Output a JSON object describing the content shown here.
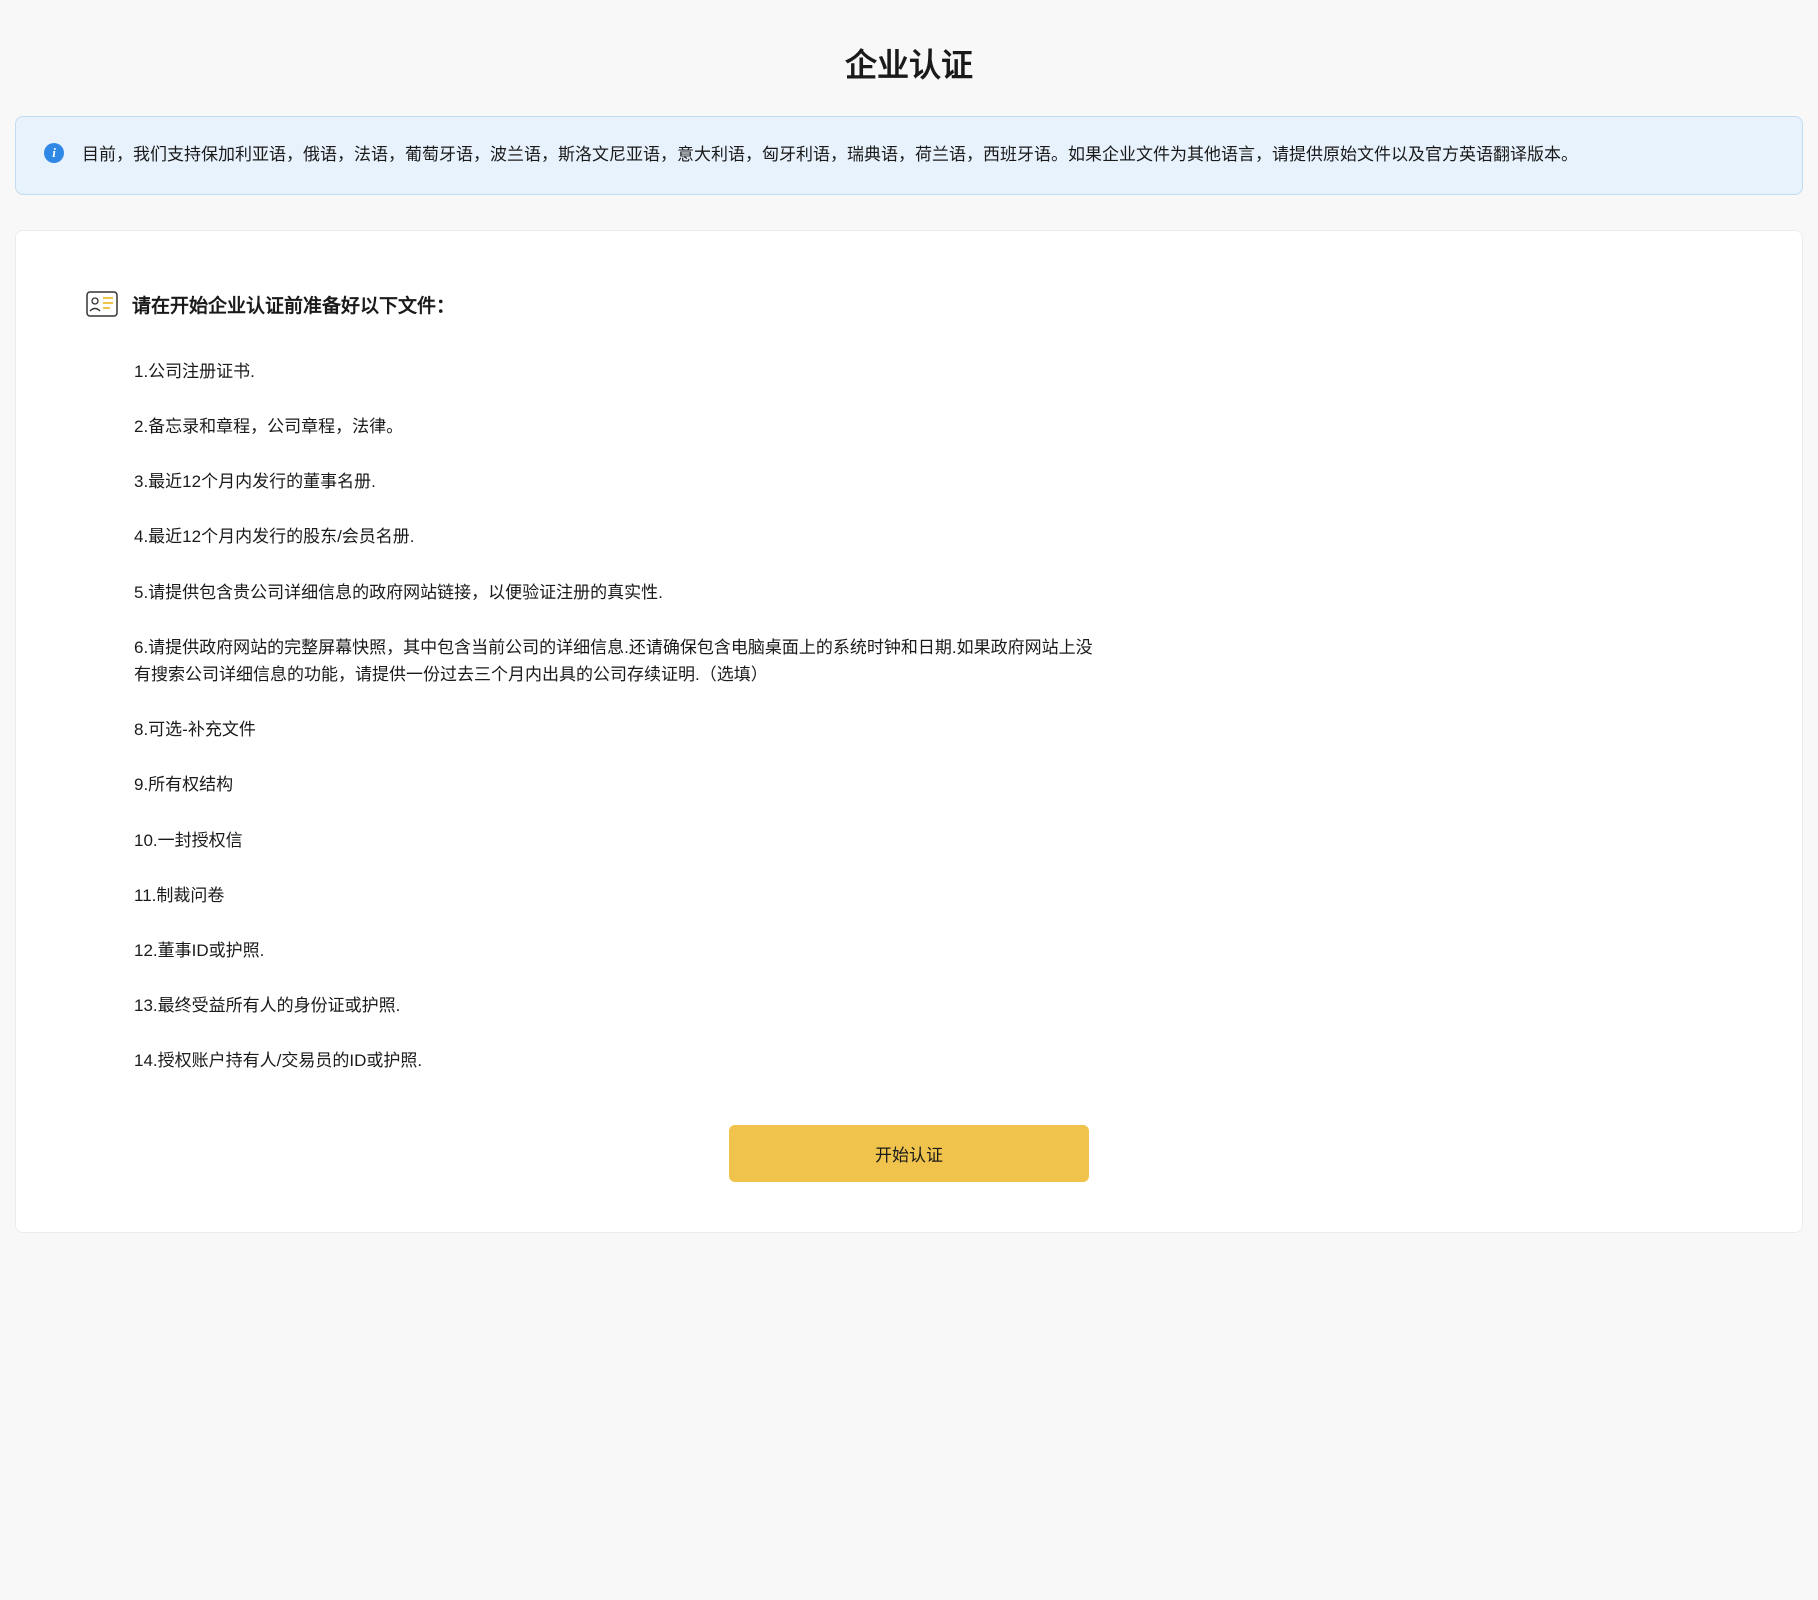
{
  "page_title": "企业认证",
  "banner": {
    "text": "目前，我们支持保加利亚语，俄语，法语，葡萄牙语，波兰语，斯洛文尼亚语，意大利语，匈牙利语，瑞典语，荷兰语，西班牙语。如果企业文件为其他语言，请提供原始文件以及官方英语翻译版本。"
  },
  "section_title": "请在开始企业认证前准备好以下文件：",
  "documents": [
    "1.公司注册证书.",
    "2.备忘录和章程，公司章程，法律。",
    "3.最近12个月内发行的董事名册.",
    "4.最近12个月内发行的股东/会员名册.",
    "5.请提供包含贵公司详细信息的政府网站链接，以便验证注册的真实性.",
    "6.请提供政府网站的完整屏幕快照，其中包含当前公司的详细信息.还请确保包含电脑桌面上的系统时钟和日期.如果政府网站上没有搜索公司详细信息的功能，请提供一份过去三个月内出具的公司存续证明.（选填）",
    "8.可选-补充文件",
    "9.所有权结构",
    "10.一封授权信",
    "11.制裁问卷",
    "12.董事ID或护照.",
    "13.最终受益所有人的身份证或护照.",
    "14.授权账户持有人/交易员的ID或护照."
  ],
  "button_label": "开始认证"
}
